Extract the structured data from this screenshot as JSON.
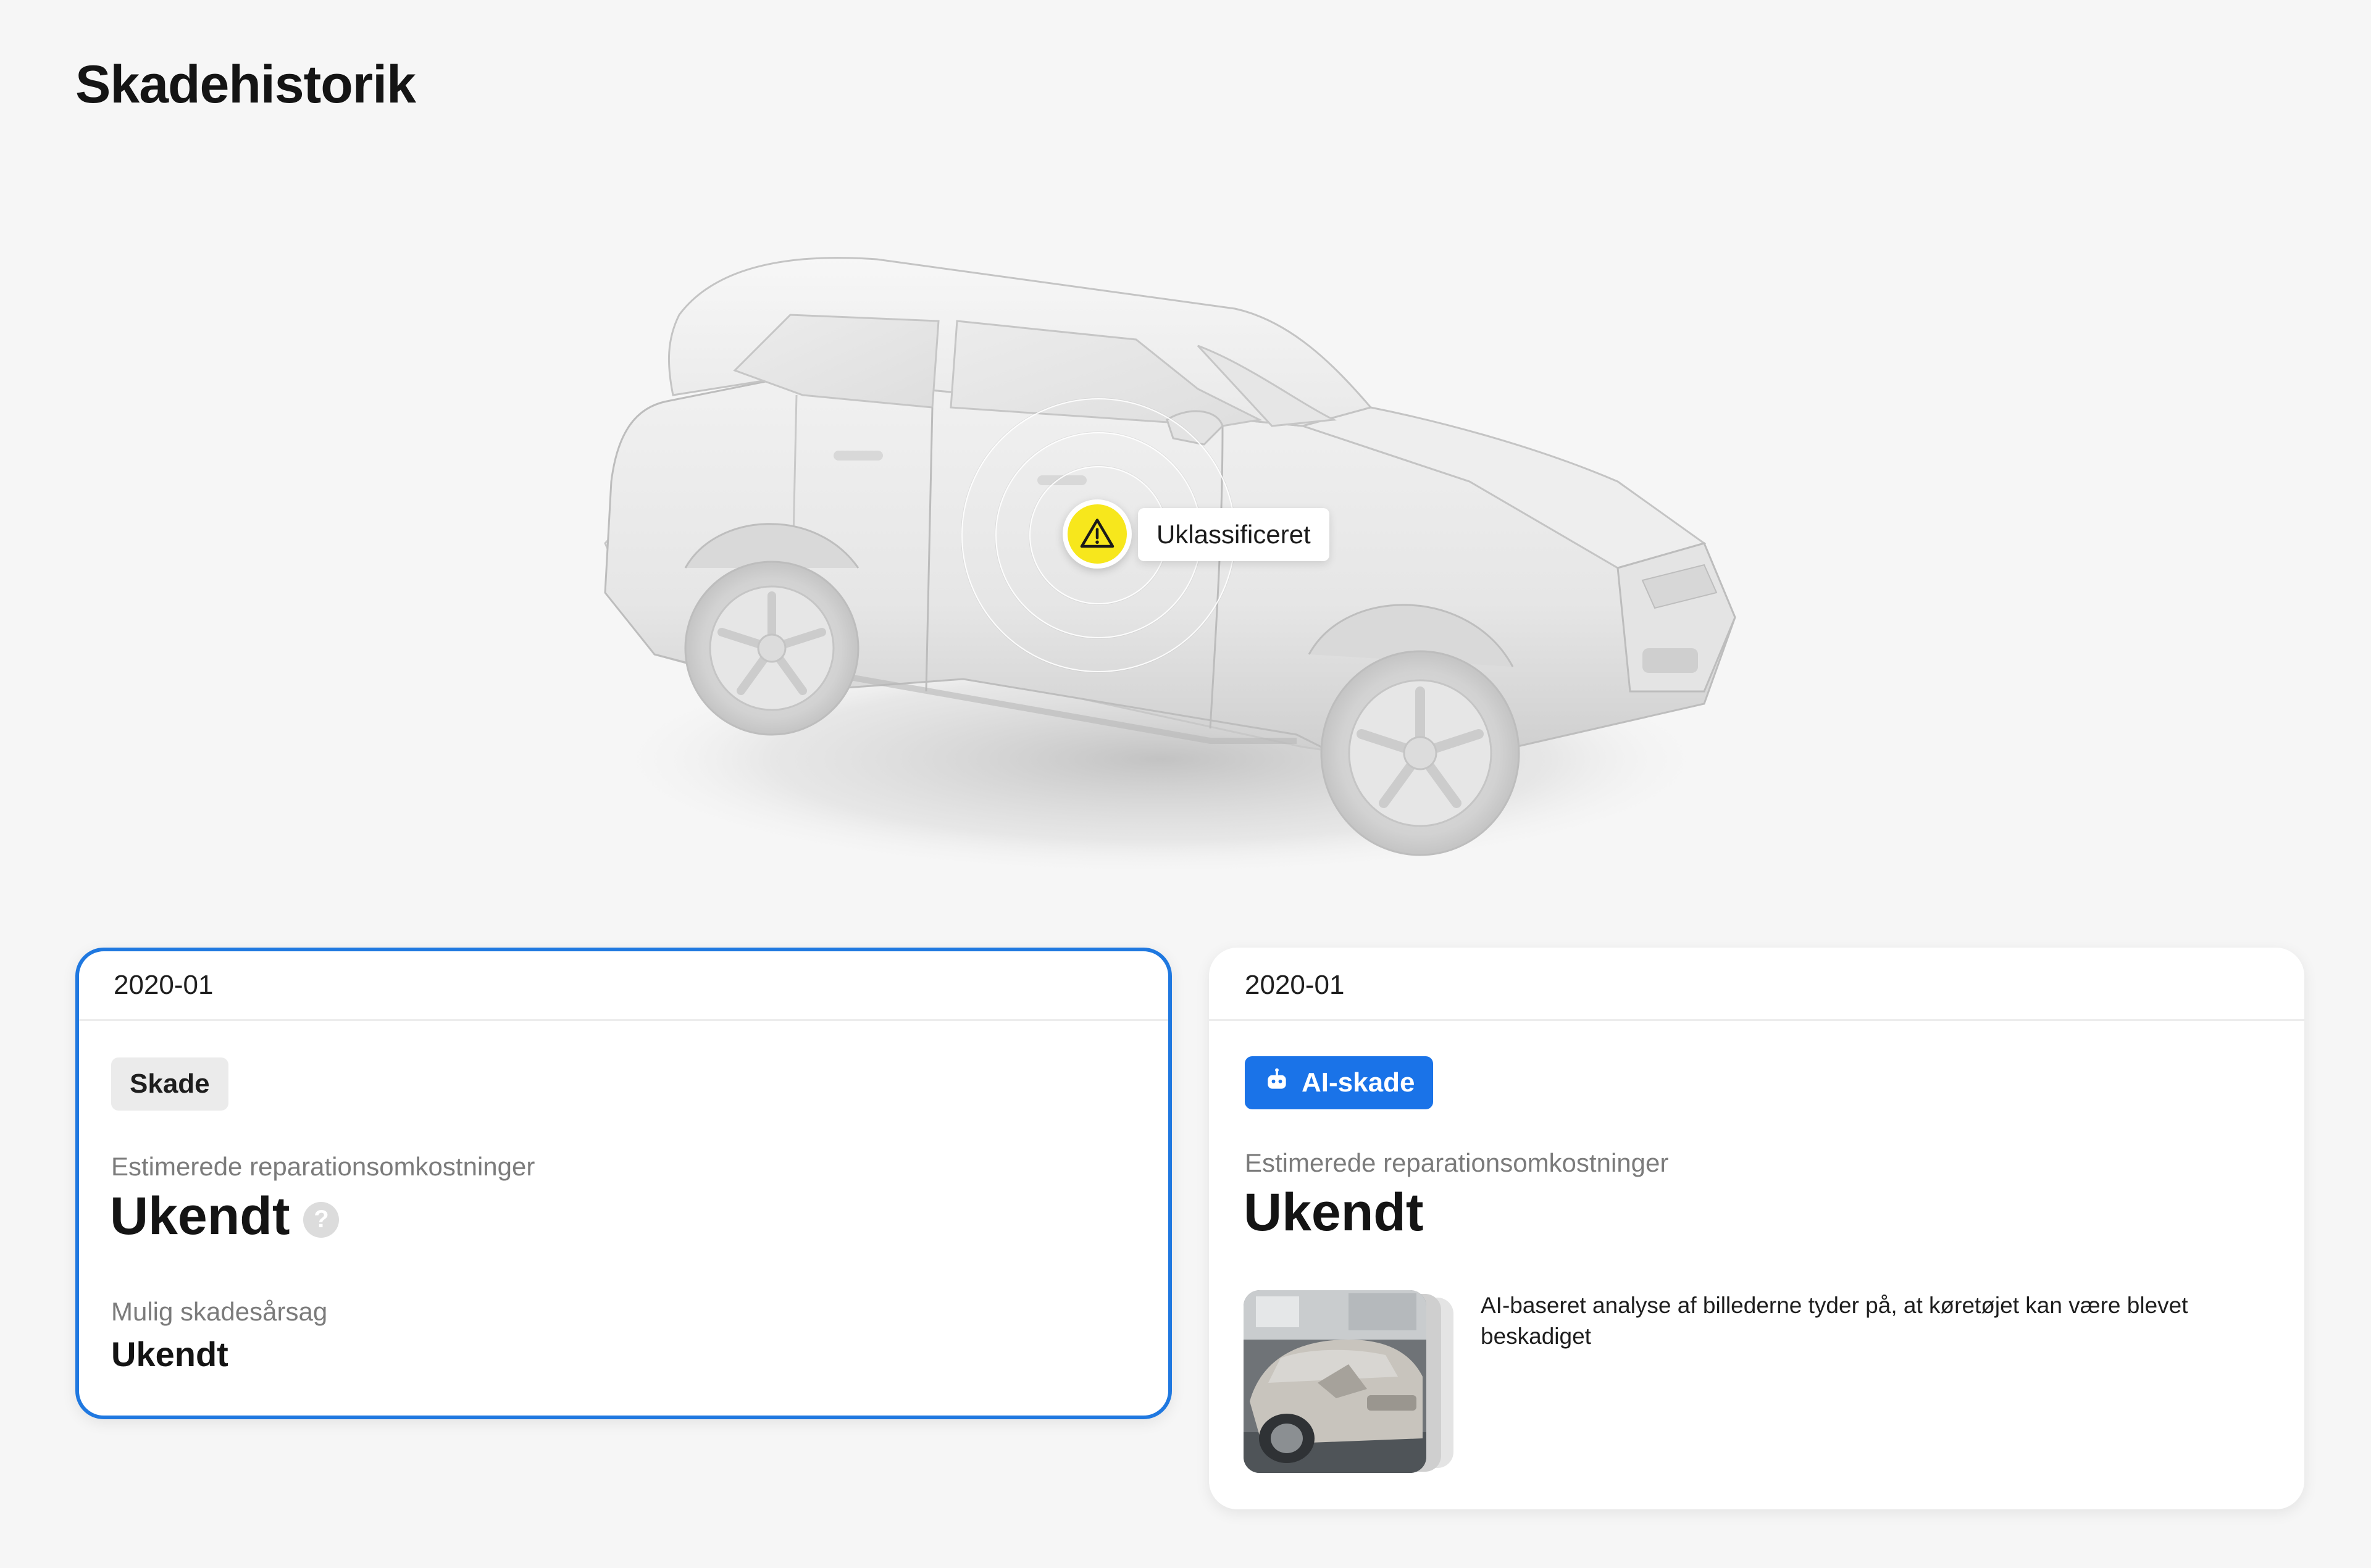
{
  "page": {
    "title": "Skadehistorik"
  },
  "vehicle": {
    "damage_marker": {
      "label": "Uklassificeret",
      "icon": "warning-triangle-icon",
      "color": "#f7e71c"
    }
  },
  "cards": [
    {
      "date": "2020-01",
      "tag": "Skade",
      "selected": true,
      "cost_label": "Estimerede reparationsomkostninger",
      "cost_value": "Ukendt",
      "help_icon": "question-icon",
      "cause_label": "Mulig skadesårsag",
      "cause_value": "Ukendt"
    },
    {
      "date": "2020-01",
      "tag": "AI-skade",
      "tag_icon": "robot-icon",
      "tag_color": "#1a73e8",
      "cost_label": "Estimerede reparationsomkostninger",
      "cost_value": "Ukendt",
      "analysis_text": "AI-baseret analyse af billederne tyder på, at køretøjet kan være blevet beskadiget"
    }
  ],
  "colors": {
    "accent": "#1f78e0",
    "background": "#f6f6f6"
  }
}
